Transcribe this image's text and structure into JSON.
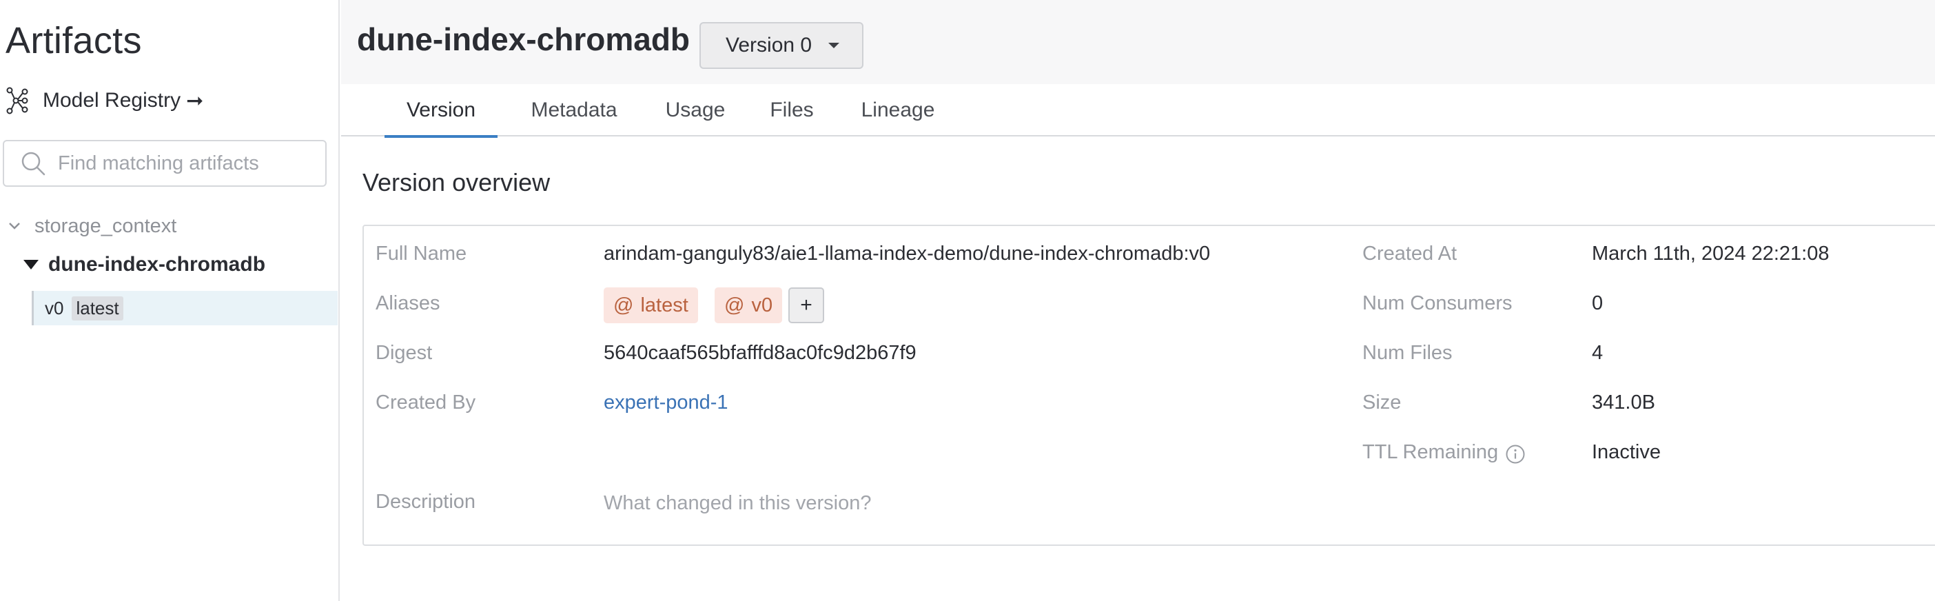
{
  "sidebar": {
    "title": "Artifacts",
    "registry_label": "Model Registry",
    "registry_arrow": "➞",
    "search_placeholder": "Find matching artifacts",
    "tree": {
      "type_name": "storage_context",
      "artifact_name": "dune-index-chromadb",
      "version": "v0",
      "version_tag": "latest"
    }
  },
  "header": {
    "artifact_title": "dune-index-chromadb",
    "version_select": "Version 0"
  },
  "tabs": [
    {
      "label": "Version",
      "active": true
    },
    {
      "label": "Metadata",
      "active": false
    },
    {
      "label": "Usage",
      "active": false
    },
    {
      "label": "Files",
      "active": false
    },
    {
      "label": "Lineage",
      "active": false
    }
  ],
  "overview": {
    "section_title": "Version overview",
    "full_name_label": "Full Name",
    "full_name": "arindam-ganguly83/aie1-llama-index-demo/dune-index-chromadb:v0",
    "aliases_label": "Aliases",
    "aliases": [
      "latest",
      "v0"
    ],
    "alias_prefix": "@",
    "add_alias": "+",
    "digest_label": "Digest",
    "digest": "5640caaf565bfafffd8ac0fc9d2b67f9",
    "created_by_label": "Created By",
    "created_by": "expert-pond-1",
    "description_label": "Description",
    "description_placeholder": "What changed in this version?",
    "created_at_label": "Created At",
    "created_at": "March 11th, 2024 22:21:08",
    "num_consumers_label": "Num Consumers",
    "num_consumers": "0",
    "num_files_label": "Num Files",
    "num_files": "4",
    "size_label": "Size",
    "size": "341.0B",
    "ttl_label": "TTL Remaining",
    "ttl": "Inactive"
  },
  "colors": {
    "accent": "#3b7fc4",
    "link": "#3a72b5",
    "alias_bg": "#fbe5e0",
    "alias_text": "#b9623f",
    "selected_row": "#e9f3f8"
  },
  "icons": [
    "model-registry-icon",
    "search-icon",
    "chevron-down-icon",
    "caret-down-icon",
    "info-icon"
  ]
}
